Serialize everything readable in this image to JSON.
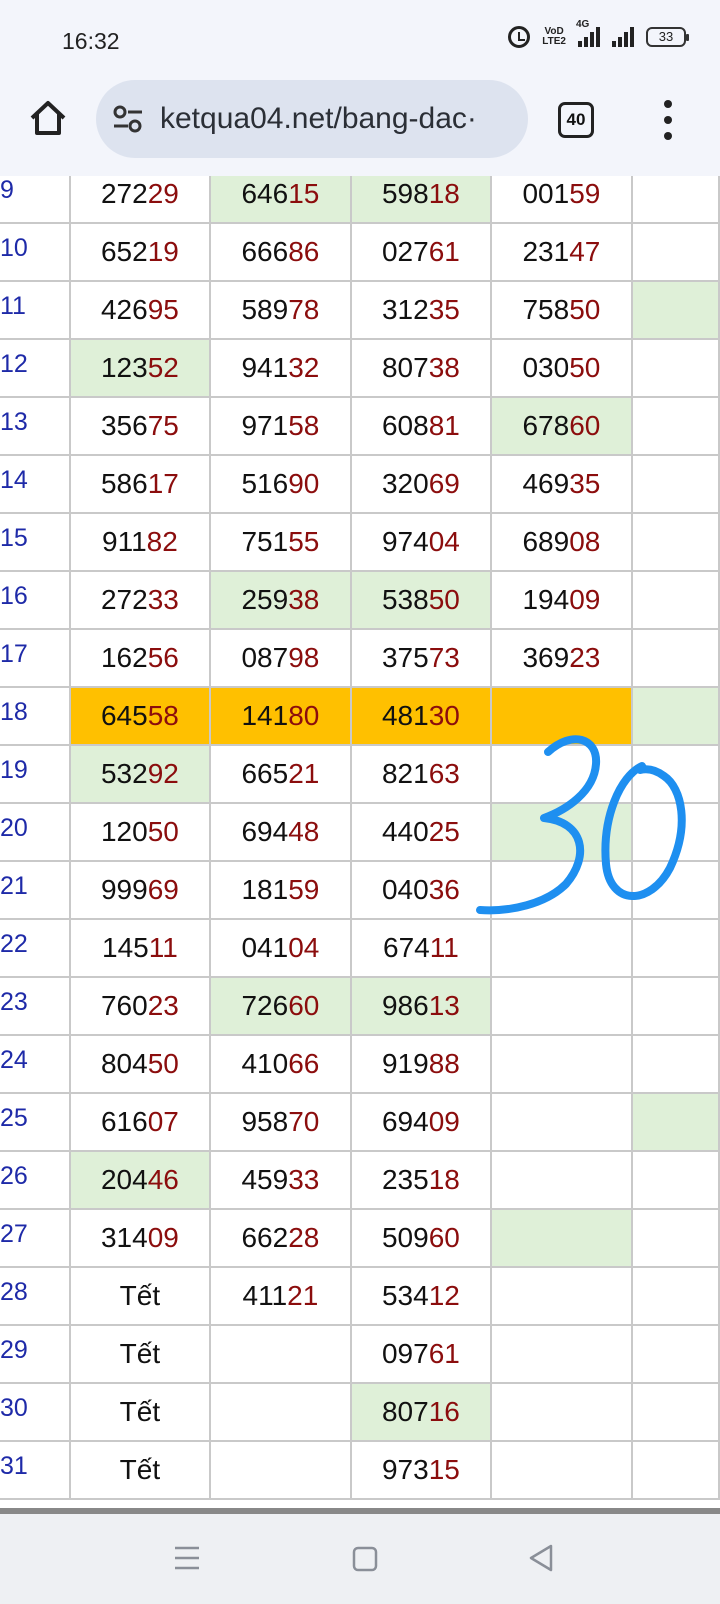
{
  "status_bar": {
    "time": "16:32",
    "volte_label": "VoD\nLTE2",
    "network_label": "4G",
    "battery": "33",
    "icons": [
      "alarm-icon",
      "volte-icon",
      "signal-icon",
      "battery-icon"
    ]
  },
  "browser": {
    "url": "ketqua04.net/bang-dac·",
    "tab_count": "40",
    "icons": [
      "home-icon",
      "tune-icon",
      "tabs-icon",
      "more-vert-icon"
    ]
  },
  "colors": {
    "highlight_green": "#dff0d8",
    "highlight_orange": "#ffc000",
    "last_two_digits": "#8b0d0d",
    "day_number": "#1e2aa8",
    "handwriting_blue": "#1e8ff0"
  },
  "table": {
    "rows": [
      {
        "day": "9",
        "cells": [
          {
            "p": "272",
            "s": "29"
          },
          {
            "p": "646",
            "s": "15",
            "hl": "green"
          },
          {
            "p": "598",
            "s": "18",
            "hl": "green"
          },
          {
            "p": "001",
            "s": "59"
          },
          {
            "p": "",
            "s": ""
          }
        ]
      },
      {
        "day": "10",
        "cells": [
          {
            "p": "652",
            "s": "19"
          },
          {
            "p": "666",
            "s": "86"
          },
          {
            "p": "027",
            "s": "61"
          },
          {
            "p": "231",
            "s": "47"
          },
          {
            "p": "",
            "s": ""
          }
        ]
      },
      {
        "day": "11",
        "cells": [
          {
            "p": "426",
            "s": "95"
          },
          {
            "p": "589",
            "s": "78"
          },
          {
            "p": "312",
            "s": "35"
          },
          {
            "p": "758",
            "s": "50"
          },
          {
            "p": "",
            "s": "",
            "hl": "green"
          }
        ]
      },
      {
        "day": "12",
        "cells": [
          {
            "p": "123",
            "s": "52",
            "hl": "green"
          },
          {
            "p": "941",
            "s": "32"
          },
          {
            "p": "807",
            "s": "38"
          },
          {
            "p": "030",
            "s": "50"
          },
          {
            "p": "",
            "s": ""
          }
        ]
      },
      {
        "day": "13",
        "cells": [
          {
            "p": "356",
            "s": "75"
          },
          {
            "p": "971",
            "s": "58"
          },
          {
            "p": "608",
            "s": "81"
          },
          {
            "p": "678",
            "s": "60",
            "hl": "green"
          },
          {
            "p": "",
            "s": ""
          }
        ]
      },
      {
        "day": "14",
        "cells": [
          {
            "p": "586",
            "s": "17"
          },
          {
            "p": "516",
            "s": "90"
          },
          {
            "p": "320",
            "s": "69"
          },
          {
            "p": "469",
            "s": "35"
          },
          {
            "p": "",
            "s": ""
          }
        ]
      },
      {
        "day": "15",
        "cells": [
          {
            "p": "911",
            "s": "82"
          },
          {
            "p": "751",
            "s": "55"
          },
          {
            "p": "974",
            "s": "04"
          },
          {
            "p": "689",
            "s": "08"
          },
          {
            "p": "",
            "s": ""
          }
        ]
      },
      {
        "day": "16",
        "cells": [
          {
            "p": "272",
            "s": "33"
          },
          {
            "p": "259",
            "s": "38",
            "hl": "green"
          },
          {
            "p": "538",
            "s": "50",
            "hl": "green"
          },
          {
            "p": "194",
            "s": "09"
          },
          {
            "p": "",
            "s": ""
          }
        ]
      },
      {
        "day": "17",
        "cells": [
          {
            "p": "162",
            "s": "56"
          },
          {
            "p": "087",
            "s": "98"
          },
          {
            "p": "375",
            "s": "73"
          },
          {
            "p": "369",
            "s": "23"
          },
          {
            "p": "",
            "s": ""
          }
        ]
      },
      {
        "day": "18",
        "cells": [
          {
            "p": "645",
            "s": "58",
            "hl": "orange"
          },
          {
            "p": "141",
            "s": "80",
            "hl": "orange"
          },
          {
            "p": "481",
            "s": "30",
            "hl": "orange"
          },
          {
            "p": "",
            "s": "",
            "hl": "orange"
          },
          {
            "p": "",
            "s": "",
            "hl": "green"
          }
        ]
      },
      {
        "day": "19",
        "cells": [
          {
            "p": "532",
            "s": "92",
            "hl": "green"
          },
          {
            "p": "665",
            "s": "21"
          },
          {
            "p": "821",
            "s": "63"
          },
          {
            "p": "",
            "s": ""
          },
          {
            "p": "",
            "s": ""
          }
        ]
      },
      {
        "day": "20",
        "cells": [
          {
            "p": "120",
            "s": "50"
          },
          {
            "p": "694",
            "s": "48"
          },
          {
            "p": "440",
            "s": "25"
          },
          {
            "p": "",
            "s": "",
            "hl": "green"
          },
          {
            "p": "",
            "s": ""
          }
        ]
      },
      {
        "day": "21",
        "cells": [
          {
            "p": "999",
            "s": "69"
          },
          {
            "p": "181",
            "s": "59"
          },
          {
            "p": "040",
            "s": "36"
          },
          {
            "p": "",
            "s": ""
          },
          {
            "p": "",
            "s": ""
          }
        ]
      },
      {
        "day": "22",
        "cells": [
          {
            "p": "145",
            "s": "11"
          },
          {
            "p": "041",
            "s": "04"
          },
          {
            "p": "674",
            "s": "11"
          },
          {
            "p": "",
            "s": ""
          },
          {
            "p": "",
            "s": ""
          }
        ]
      },
      {
        "day": "23",
        "cells": [
          {
            "p": "760",
            "s": "23"
          },
          {
            "p": "726",
            "s": "60",
            "hl": "green"
          },
          {
            "p": "986",
            "s": "13",
            "hl": "green"
          },
          {
            "p": "",
            "s": ""
          },
          {
            "p": "",
            "s": ""
          }
        ]
      },
      {
        "day": "24",
        "cells": [
          {
            "p": "804",
            "s": "50"
          },
          {
            "p": "410",
            "s": "66"
          },
          {
            "p": "919",
            "s": "88"
          },
          {
            "p": "",
            "s": ""
          },
          {
            "p": "",
            "s": ""
          }
        ]
      },
      {
        "day": "25",
        "cells": [
          {
            "p": "616",
            "s": "07"
          },
          {
            "p": "958",
            "s": "70"
          },
          {
            "p": "694",
            "s": "09"
          },
          {
            "p": "",
            "s": ""
          },
          {
            "p": "",
            "s": "",
            "hl": "green"
          }
        ]
      },
      {
        "day": "26",
        "cells": [
          {
            "p": "204",
            "s": "46",
            "hl": "green"
          },
          {
            "p": "459",
            "s": "33"
          },
          {
            "p": "235",
            "s": "18"
          },
          {
            "p": "",
            "s": ""
          },
          {
            "p": "",
            "s": ""
          }
        ]
      },
      {
        "day": "27",
        "cells": [
          {
            "p": "314",
            "s": "09"
          },
          {
            "p": "662",
            "s": "28"
          },
          {
            "p": "509",
            "s": "60"
          },
          {
            "p": "",
            "s": "",
            "hl": "green"
          },
          {
            "p": "",
            "s": ""
          }
        ]
      },
      {
        "day": "28",
        "cells": [
          {
            "p": "Tết",
            "s": ""
          },
          {
            "p": "411",
            "s": "21"
          },
          {
            "p": "534",
            "s": "12"
          },
          {
            "p": "",
            "s": ""
          },
          {
            "p": "",
            "s": ""
          }
        ]
      },
      {
        "day": "29",
        "cells": [
          {
            "p": "Tết",
            "s": ""
          },
          {
            "p": "",
            "s": ""
          },
          {
            "p": "097",
            "s": "61"
          },
          {
            "p": "",
            "s": ""
          },
          {
            "p": "",
            "s": ""
          }
        ]
      },
      {
        "day": "30",
        "cells": [
          {
            "p": "Tết",
            "s": ""
          },
          {
            "p": "",
            "s": ""
          },
          {
            "p": "807",
            "s": "16",
            "hl": "green"
          },
          {
            "p": "",
            "s": ""
          },
          {
            "p": "",
            "s": ""
          }
        ]
      },
      {
        "day": "31",
        "cells": [
          {
            "p": "Tết",
            "s": ""
          },
          {
            "p": "",
            "s": ""
          },
          {
            "p": "973",
            "s": "15"
          },
          {
            "p": "",
            "s": ""
          },
          {
            "p": "",
            "s": ""
          }
        ]
      }
    ]
  },
  "annotation": {
    "handwritten_text": "30"
  },
  "nav_bar": {
    "icons": [
      "recents-icon",
      "home-nav-icon",
      "back-icon"
    ]
  }
}
